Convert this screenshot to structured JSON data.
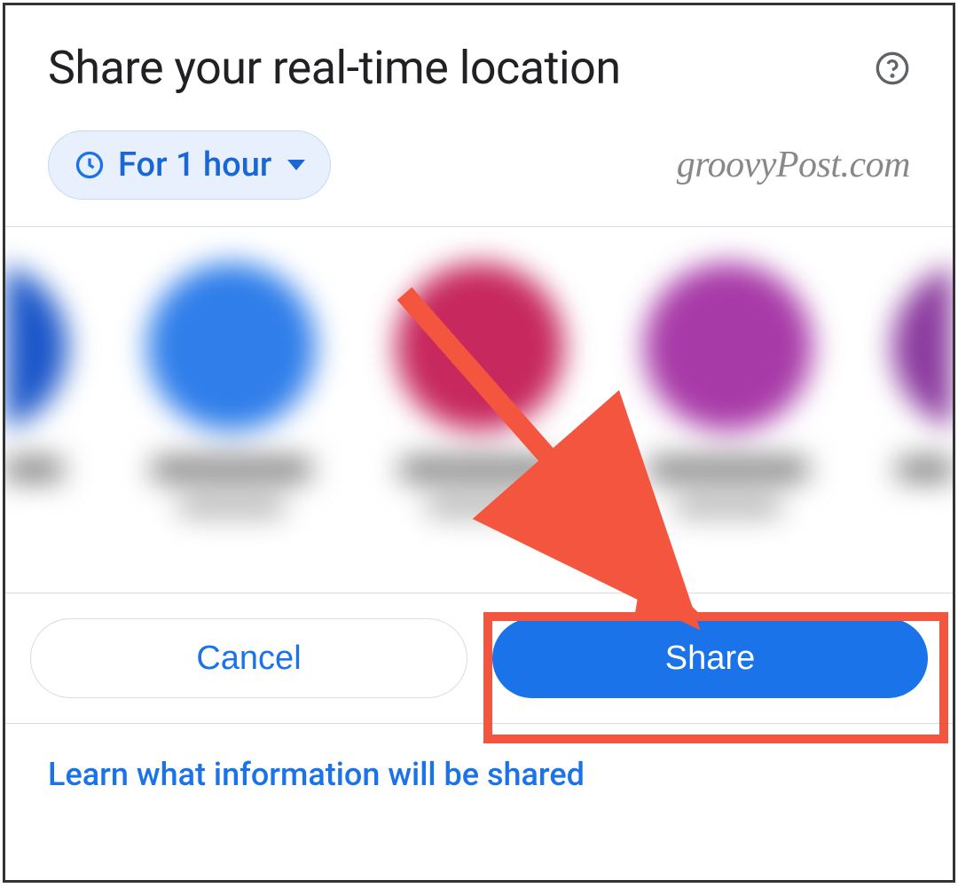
{
  "header": {
    "title": "Share your real-time location"
  },
  "duration": {
    "label": "For 1 hour"
  },
  "watermark": "groovyPost.com",
  "contacts": {
    "avatars": [
      {
        "color": "#1a56c9"
      },
      {
        "color": "#2f7eea"
      },
      {
        "color": "#c7285e"
      },
      {
        "color": "#a83aa8"
      },
      {
        "color": "#8b3a9e"
      }
    ]
  },
  "buttons": {
    "cancel": "Cancel",
    "share": "Share"
  },
  "footer": {
    "link": "Learn what information will be shared"
  },
  "annotation": {
    "color": "#f4553e"
  }
}
